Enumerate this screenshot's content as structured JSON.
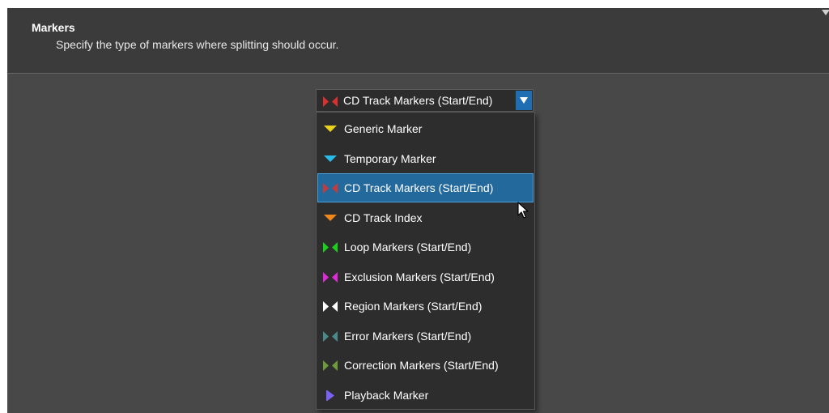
{
  "header": {
    "title": "Markers",
    "description": "Specify the type of markers where splitting should occur."
  },
  "dropdown": {
    "selected_label": "CD Track Markers (Start/End)",
    "selected_icon": "cd-track-markers-icon",
    "selected_color": "#d93030"
  },
  "menu": {
    "items": [
      {
        "label": "Generic Marker",
        "icon": "generic-marker-icon",
        "color": "#e8d21b",
        "shape": "triangle-down"
      },
      {
        "label": "Temporary Marker",
        "icon": "temporary-marker-icon",
        "color": "#2bbbe8",
        "shape": "triangle-down"
      },
      {
        "label": "CD Track Markers (Start/End)",
        "icon": "cd-track-markers-icon",
        "color": "#c63a3a",
        "shape": "bowtie",
        "selected": true
      },
      {
        "label": "CD Track Index",
        "icon": "cd-track-index-icon",
        "color": "#f0871a",
        "shape": "triangle-down"
      },
      {
        "label": "Loop Markers (Start/End)",
        "icon": "loop-markers-icon",
        "color": "#1ad11a",
        "shape": "bowtie"
      },
      {
        "label": "Exclusion Markers (Start/End)",
        "icon": "exclusion-markers-icon",
        "color": "#de2ad8",
        "shape": "bowtie"
      },
      {
        "label": "Region Markers (Start/End)",
        "icon": "region-markers-icon",
        "color": "#ffffff",
        "shape": "bowtie"
      },
      {
        "label": "Error Markers (Start/End)",
        "icon": "error-markers-icon",
        "color": "#4a8a8a",
        "shape": "bowtie"
      },
      {
        "label": "Correction Markers (Start/End)",
        "icon": "correction-markers-icon",
        "color": "#6e9a3c",
        "shape": "bowtie"
      },
      {
        "label": "Playback Marker",
        "icon": "playback-marker-icon",
        "color": "#7b62f2",
        "shape": "triangle-right"
      }
    ]
  }
}
